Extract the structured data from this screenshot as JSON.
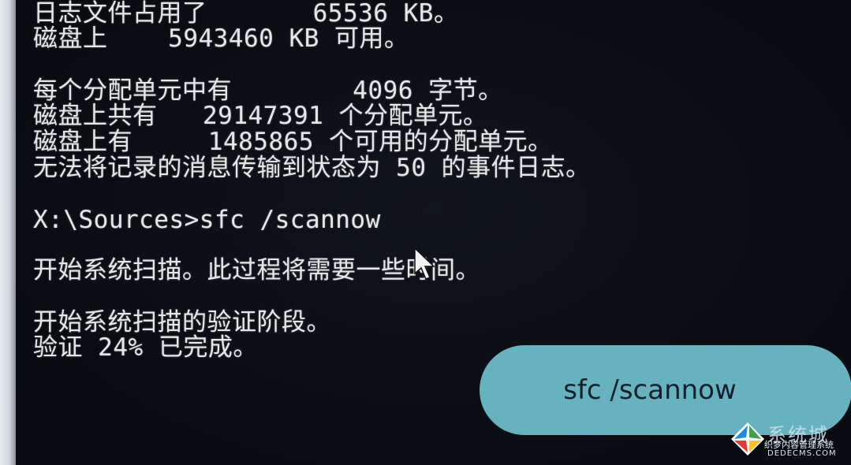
{
  "console": {
    "lines": [
      "日志文件占用了       65536 KB。",
      "磁盘上    5943460 KB 可用。",
      "每个分配单元中有        4096 字节。",
      "磁盘上共有   29147391 个分配单元。",
      "磁盘上有     1485865 个可用的分配单元。",
      "无法将记录的消息传输到状态为 50 的事件日志。",
      "X:\\Sources>sfc /scannow",
      "开始系统扫描。此过程将需要一些时间。",
      "开始系统扫描的验证阶段。",
      "验证 24% 已完成。"
    ]
  },
  "overlay": {
    "command_label": "sfc /scannow"
  },
  "watermark": {
    "title": "系统城",
    "subtitle": "织梦内容管理系统",
    "url": "DEDECMS.COM"
  },
  "icons": {
    "cursor": "mouse-pointer-icon",
    "logo": "windows-logo-icon"
  },
  "colors": {
    "background": "#0a0d12",
    "text": "#e6e6e6",
    "pill": "#66b3bf",
    "pill_text": "#12202a"
  }
}
